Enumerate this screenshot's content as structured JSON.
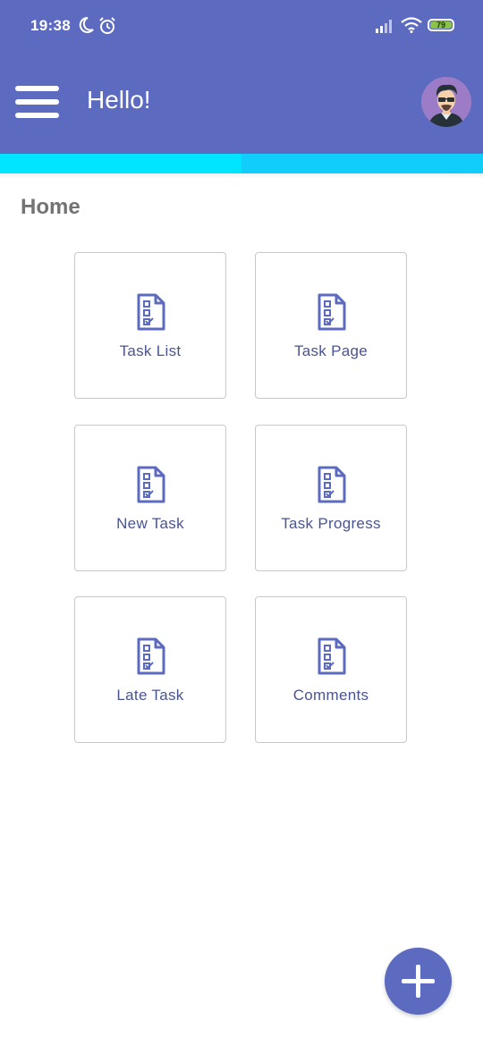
{
  "status_bar": {
    "time": "19:38",
    "battery": "79",
    "icons": [
      "moon-icon",
      "alarm-icon",
      "signal-icon",
      "wifi-icon",
      "battery-icon"
    ]
  },
  "app_bar": {
    "title": "Hello!",
    "menu_icon": "hamburger-menu-icon",
    "avatar_icon": "user-avatar"
  },
  "section": {
    "title": "Home"
  },
  "cards": [
    {
      "label": "Task List",
      "icon": "task-document-icon"
    },
    {
      "label": "Task Page",
      "icon": "task-document-icon"
    },
    {
      "label": "New Task",
      "icon": "task-document-icon"
    },
    {
      "label": "Task Progress",
      "icon": "task-document-icon"
    },
    {
      "label": "Late Task",
      "icon": "task-document-icon"
    },
    {
      "label": "Comments",
      "icon": "task-document-icon"
    }
  ],
  "fab": {
    "icon": "plus-icon"
  },
  "colors": {
    "primary": "#5c6bc0",
    "accent": "#00e5ff",
    "card_text": "#4a5490",
    "section_title": "#737373"
  }
}
